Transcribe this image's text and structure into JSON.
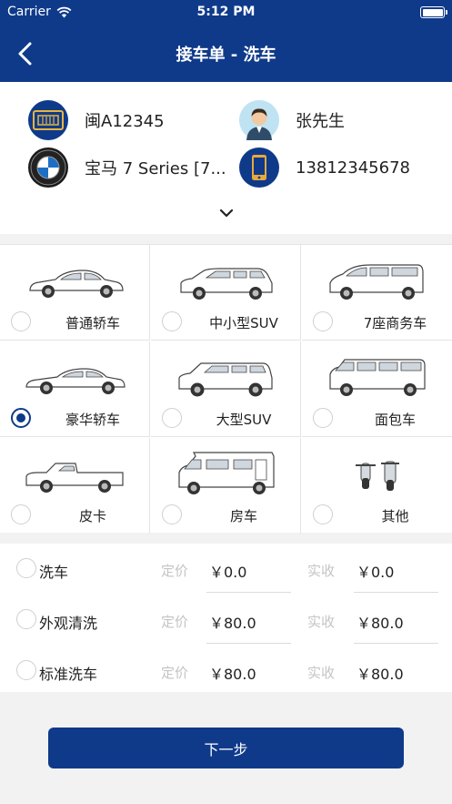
{
  "status_bar": {
    "carrier": "Carrier",
    "time": "5:12 PM"
  },
  "nav": {
    "title": "接车单 - 洗车"
  },
  "vehicle": {
    "plate": "闽A12345",
    "owner": "张先生",
    "model": "宝马 7 Series [7...",
    "phone": "13812345678"
  },
  "car_types": [
    {
      "label": "普通轿车",
      "checked": false
    },
    {
      "label": "中小型SUV",
      "checked": false
    },
    {
      "label": "7座商务车",
      "checked": false
    },
    {
      "label": "豪华轿车",
      "checked": true
    },
    {
      "label": "大型SUV",
      "checked": false
    },
    {
      "label": "面包车",
      "checked": false
    },
    {
      "label": "皮卡",
      "checked": false
    },
    {
      "label": "房车",
      "checked": false
    },
    {
      "label": "其他",
      "checked": false
    }
  ],
  "services": {
    "list_price_label": "定价",
    "actual_label": "实收",
    "items": [
      {
        "name": "洗车",
        "list_price": "￥0.0",
        "actual": "￥0.0"
      },
      {
        "name": "外观清洗",
        "list_price": "￥80.0",
        "actual": "￥80.0"
      },
      {
        "name": "标准洗车",
        "list_price": "￥80.0",
        "actual": "￥80.0"
      }
    ]
  },
  "next_button": "下一步",
  "colors": {
    "primary": "#0f3a8a",
    "background": "#f2f2f2"
  }
}
